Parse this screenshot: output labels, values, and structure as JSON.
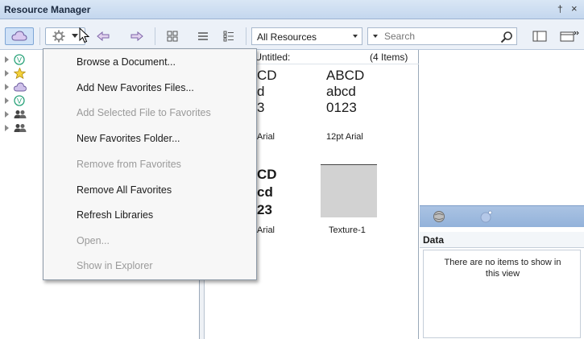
{
  "window": {
    "title": "Resource Manager",
    "pin_glyph": "†",
    "close_glyph": "×"
  },
  "toolbar": {
    "resource_filter": {
      "selected": "All Resources"
    },
    "search": {
      "placeholder": "Search",
      "value": ""
    }
  },
  "menu": {
    "items": [
      {
        "label": "Browse a Document...",
        "enabled": true
      },
      {
        "label": "Add New Favorites Files...",
        "enabled": true
      },
      {
        "label": "Add Selected File to Favorites",
        "enabled": false
      },
      {
        "label": "New Favorites Folder...",
        "enabled": true
      },
      {
        "label": "Remove from Favorites",
        "enabled": false
      },
      {
        "label": "Remove All Favorites",
        "enabled": true
      },
      {
        "label": "Refresh Libraries",
        "enabled": true
      },
      {
        "label": "Open...",
        "enabled": false
      },
      {
        "label": "Show in Explorer",
        "enabled": false
      }
    ]
  },
  "tree": {
    "items": [
      {
        "icon": "vault-icon"
      },
      {
        "icon": "star-icon"
      },
      {
        "icon": "cloud-icon"
      },
      {
        "icon": "vault-icon"
      },
      {
        "icon": "users-icon"
      },
      {
        "icon": "users-icon"
      }
    ]
  },
  "browser": {
    "path": "\\Untitled:",
    "count": "(4 Items)",
    "items": [
      {
        "l1": "CD",
        "l2": "d",
        "l3": "3",
        "caption": "Arial"
      },
      {
        "l1": "ABCD",
        "l2": "abcd",
        "l3": "0123",
        "caption": "12pt Arial"
      },
      {
        "l1": "CD",
        "l2": "cd",
        "l3": "23",
        "caption": "Arial"
      },
      {
        "caption": "Texture-1"
      }
    ]
  },
  "data_panel": {
    "header": "Data",
    "empty_line1": "There are no items to show in",
    "empty_line2": "this view"
  },
  "colors": {
    "accent": "#cfe1f7",
    "titlebar": "#c4d7ee",
    "preview_bar": "#93b2da"
  }
}
